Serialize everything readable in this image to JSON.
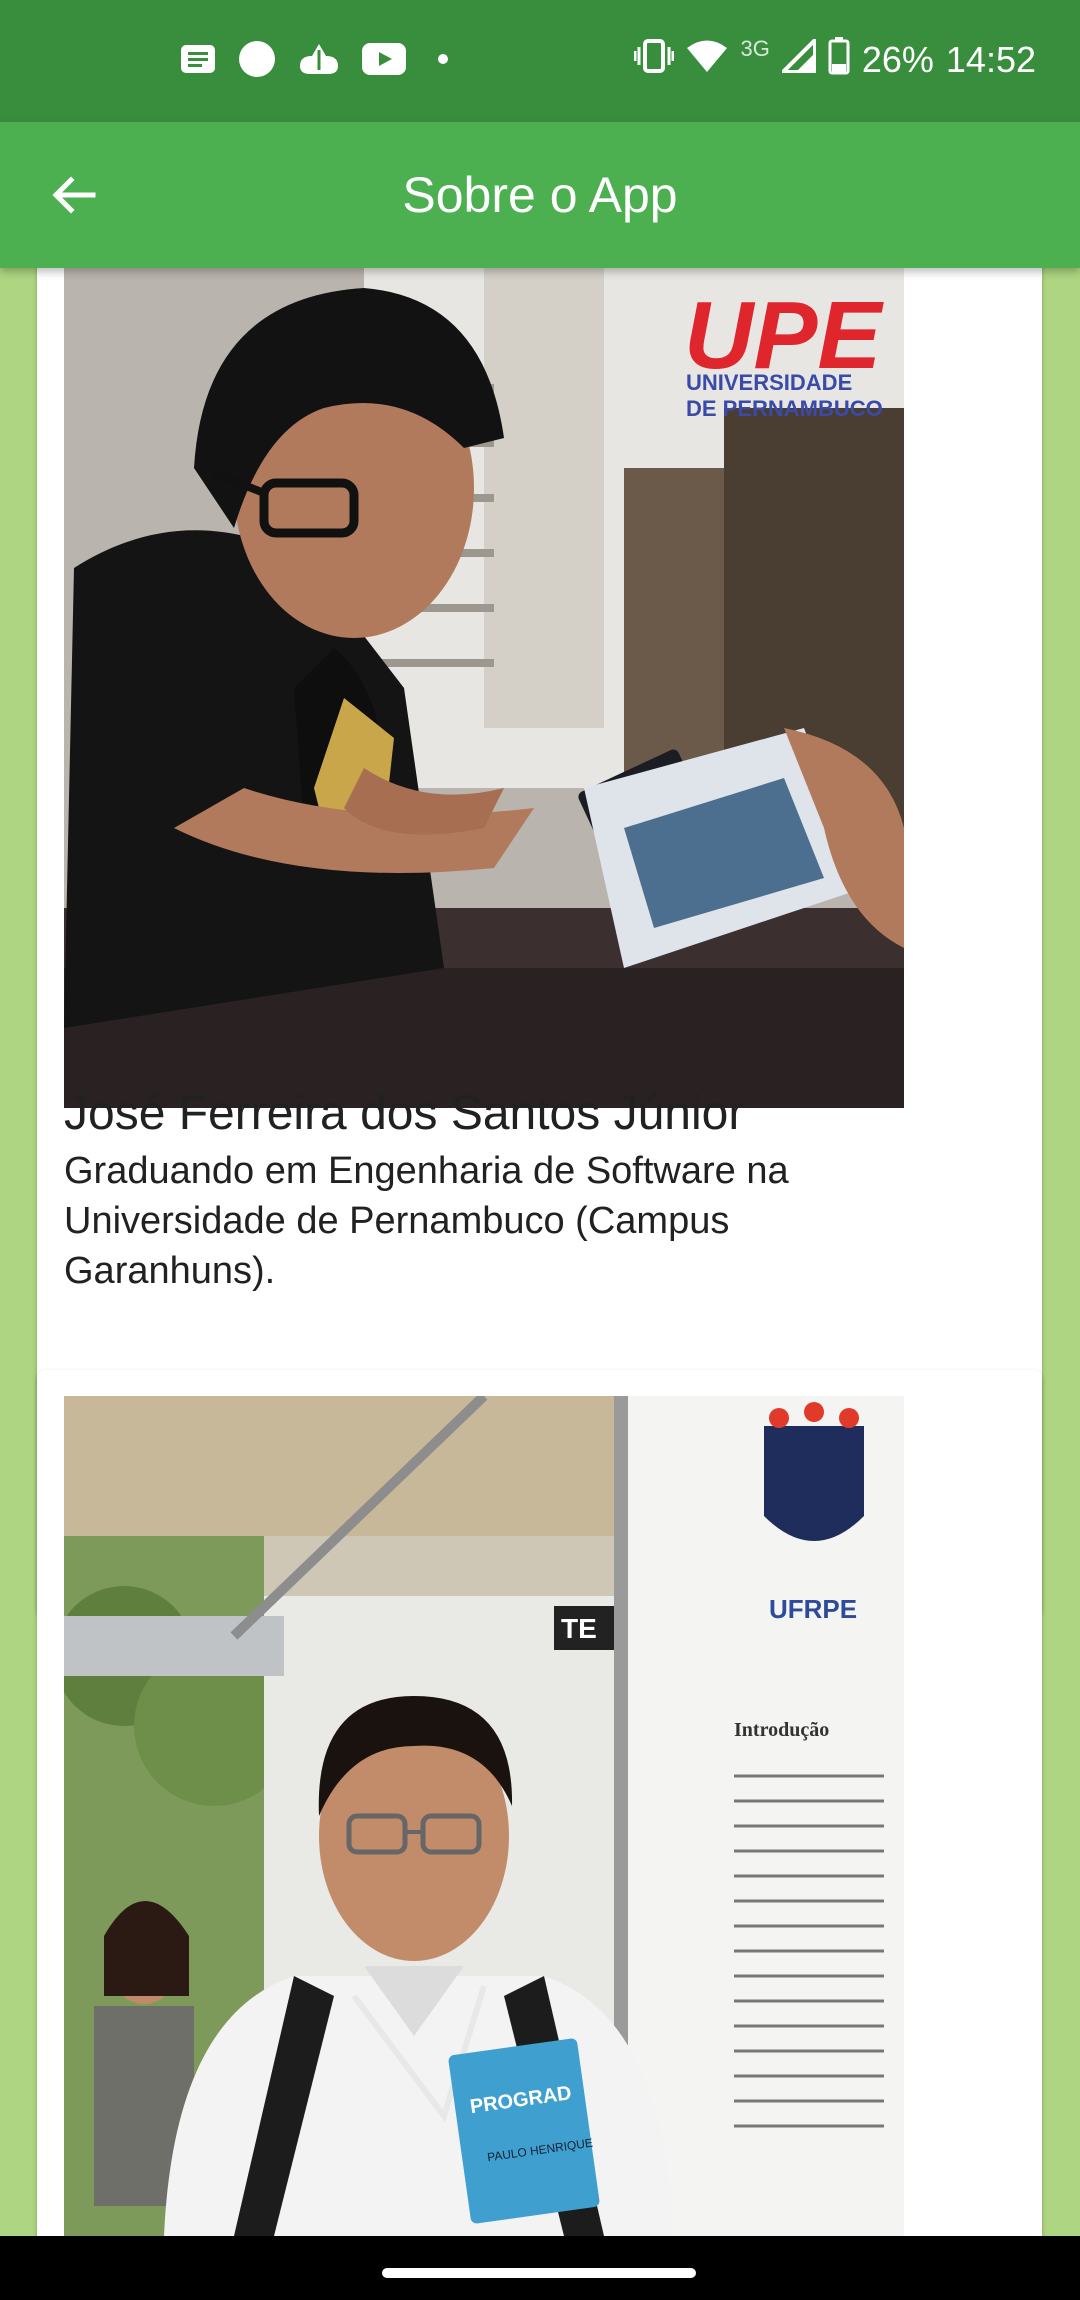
{
  "status_bar": {
    "time": "14:52",
    "battery": "26%",
    "network": "3G",
    "left_icons": [
      "notification-icon",
      "circle-icon",
      "cloud-icon",
      "youtube-icon",
      "dot-icon"
    ],
    "right_icons": [
      "vibrate-icon",
      "wifi-icon",
      "signal-icon",
      "battery-icon"
    ]
  },
  "app_bar": {
    "title": "Sobre o App",
    "back_icon": "arrow-left-icon"
  },
  "members": [
    {
      "name": "José Ferreira dos Santos Júnior",
      "description": "Graduando em Engenharia de Software na Universidade de Pernambuco (Campus Garanhuns).",
      "photo_logo": {
        "mark": "UPE",
        "line1": "UNIVERSIDADE",
        "line2": "DE PERNAMBUCO"
      }
    },
    {
      "photo_logo": {
        "mark": "UFRPE",
        "banner": "TE",
        "section": "Introdução"
      },
      "badge_event": "PROGRAD",
      "badge_name": "PAULO HENRIQUE"
    }
  ],
  "colors": {
    "status_bar": "#388e3c",
    "app_bar": "#4caf50",
    "background": "#aed581",
    "card": "#ffffff"
  }
}
